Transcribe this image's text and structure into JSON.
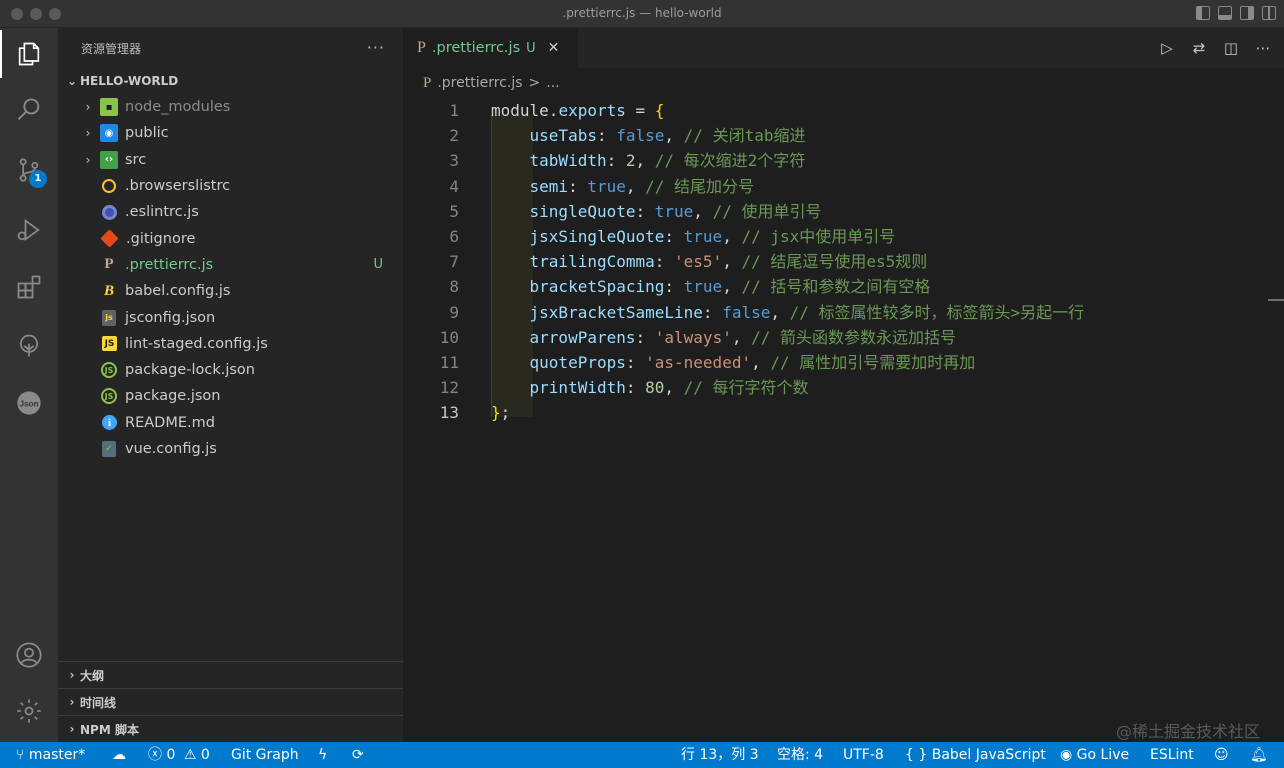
{
  "window": {
    "title": ".prettierrc.js — hello-world"
  },
  "activity_bar": {
    "items": [
      "explorer-icon",
      "search-icon",
      "source-control-icon",
      "run-debug-icon",
      "extensions-icon",
      "git-graph-icon",
      "json-icon",
      "account-icon",
      "settings-gear-icon"
    ],
    "source_control_badge": "1",
    "json_label": "Json"
  },
  "sidebar": {
    "title": "资源管理器",
    "more": "···",
    "workspace": "HELLO-WORLD",
    "tree": [
      {
        "name": "node_modules",
        "folder": true,
        "icon": "node-folder-icon",
        "dim": true
      },
      {
        "name": "public",
        "folder": true,
        "icon": "public-folder-icon"
      },
      {
        "name": "src",
        "folder": true,
        "icon": "src-folder-icon"
      },
      {
        "name": ".browserslistrc",
        "icon": "browserslist-icon"
      },
      {
        "name": ".eslintrc.js",
        "icon": "eslint-icon"
      },
      {
        "name": ".gitignore",
        "icon": "git-icon"
      },
      {
        "name": ".prettierrc.js",
        "icon": "prettier-icon",
        "status": "U"
      },
      {
        "name": "babel.config.js",
        "icon": "babel-icon"
      },
      {
        "name": "jsconfig.json",
        "icon": "jsconfig-icon"
      },
      {
        "name": "lint-staged.config.js",
        "icon": "js-file-icon"
      },
      {
        "name": "package-lock.json",
        "icon": "npm-json-icon"
      },
      {
        "name": "package.json",
        "icon": "npm-json-icon"
      },
      {
        "name": "README.md",
        "icon": "info-icon"
      },
      {
        "name": "vue.config.js",
        "icon": "vue-config-icon"
      }
    ],
    "bottom_sections": [
      "大纲",
      "时间线",
      "NPM 脚本"
    ]
  },
  "editor": {
    "tab": {
      "label": ".prettierrc.js",
      "status": "U",
      "close": "✕"
    },
    "breadcrumb": {
      "file": ".prettierrc.js",
      "sep": ">",
      "more": "..."
    },
    "actions": [
      "run-icon",
      "compare-changes-icon",
      "split-editor-icon",
      "more-actions-icon"
    ],
    "lines": [
      {
        "n": "1",
        "tokens": [
          [
            "mod",
            "module"
          ],
          [
            "punc",
            "."
          ],
          [
            "var",
            "exports"
          ],
          [
            "plain",
            " = "
          ],
          [
            "brace",
            "{"
          ]
        ]
      },
      {
        "n": "2",
        "tokens": [
          [
            "plain",
            "    "
          ],
          [
            "prop",
            "useTabs"
          ],
          [
            "punc",
            ": "
          ],
          [
            "bool",
            "false"
          ],
          [
            "punc",
            ", "
          ],
          [
            "com",
            "// 关闭tab缩进"
          ]
        ]
      },
      {
        "n": "3",
        "tokens": [
          [
            "plain",
            "    "
          ],
          [
            "prop",
            "tabWidth"
          ],
          [
            "punc",
            ": "
          ],
          [
            "num",
            "2"
          ],
          [
            "punc",
            ", "
          ],
          [
            "com",
            "// 每次缩进2个字符"
          ]
        ]
      },
      {
        "n": "4",
        "tokens": [
          [
            "plain",
            "    "
          ],
          [
            "prop",
            "semi"
          ],
          [
            "punc",
            ": "
          ],
          [
            "bool",
            "true"
          ],
          [
            "punc",
            ", "
          ],
          [
            "com",
            "// 结尾加分号"
          ]
        ]
      },
      {
        "n": "5",
        "tokens": [
          [
            "plain",
            "    "
          ],
          [
            "prop",
            "singleQuote"
          ],
          [
            "punc",
            ": "
          ],
          [
            "bool",
            "true"
          ],
          [
            "punc",
            ", "
          ],
          [
            "com",
            "// 使用单引号"
          ]
        ]
      },
      {
        "n": "6",
        "tokens": [
          [
            "plain",
            "    "
          ],
          [
            "prop",
            "jsxSingleQuote"
          ],
          [
            "punc",
            ": "
          ],
          [
            "bool",
            "true"
          ],
          [
            "punc",
            ", "
          ],
          [
            "com",
            "// jsx中使用单引号"
          ]
        ]
      },
      {
        "n": "7",
        "tokens": [
          [
            "plain",
            "    "
          ],
          [
            "prop",
            "trailingComma"
          ],
          [
            "punc",
            ": "
          ],
          [
            "str",
            "'es5'"
          ],
          [
            "punc",
            ", "
          ],
          [
            "com",
            "// 结尾逗号使用es5规则"
          ]
        ]
      },
      {
        "n": "8",
        "tokens": [
          [
            "plain",
            "    "
          ],
          [
            "prop",
            "bracketSpacing"
          ],
          [
            "punc",
            ": "
          ],
          [
            "bool",
            "true"
          ],
          [
            "punc",
            ", "
          ],
          [
            "com",
            "// 括号和参数之间有空格"
          ]
        ]
      },
      {
        "n": "9",
        "tokens": [
          [
            "plain",
            "    "
          ],
          [
            "prop",
            "jsxBracketSameLine"
          ],
          [
            "punc",
            ": "
          ],
          [
            "bool",
            "false"
          ],
          [
            "punc",
            ", "
          ],
          [
            "com",
            "// 标签属性较多时，标签箭头>另起一行"
          ]
        ]
      },
      {
        "n": "10",
        "tokens": [
          [
            "plain",
            "    "
          ],
          [
            "prop",
            "arrowParens"
          ],
          [
            "punc",
            ": "
          ],
          [
            "str",
            "'always'"
          ],
          [
            "punc",
            ", "
          ],
          [
            "com",
            "// 箭头函数参数永远加括号"
          ]
        ]
      },
      {
        "n": "11",
        "tokens": [
          [
            "plain",
            "    "
          ],
          [
            "prop",
            "quoteProps"
          ],
          [
            "punc",
            ": "
          ],
          [
            "str",
            "'as-needed'"
          ],
          [
            "punc",
            ", "
          ],
          [
            "com",
            "// 属性加引号需要加时再加"
          ]
        ]
      },
      {
        "n": "12",
        "tokens": [
          [
            "plain",
            "    "
          ],
          [
            "prop",
            "printWidth"
          ],
          [
            "punc",
            ": "
          ],
          [
            "num",
            "80"
          ],
          [
            "punc",
            ", "
          ],
          [
            "com",
            "// 每行字符个数"
          ]
        ]
      },
      {
        "n": "13",
        "tokens": [
          [
            "brace",
            "}"
          ],
          [
            "punc",
            ";"
          ]
        ],
        "current": true
      }
    ]
  },
  "watermark": "@稀土掘金技术社区",
  "status_bar": {
    "branch": "master*",
    "sync_icon": "cloud-sync-icon",
    "errors": "0",
    "warnings": "0",
    "git_graph": "Git Graph",
    "lightning_icon": "lightning-icon",
    "refresh_icon": "refresh-icon",
    "cursor": "行 13，列 3",
    "indent": "空格: 4",
    "encoding": "UTF-8",
    "language": "{ } Babel JavaScript",
    "golive": "Go Live",
    "eslint": "ESLint",
    "feedback_icon": "feedback-icon",
    "bell_icon": "bell-icon"
  }
}
